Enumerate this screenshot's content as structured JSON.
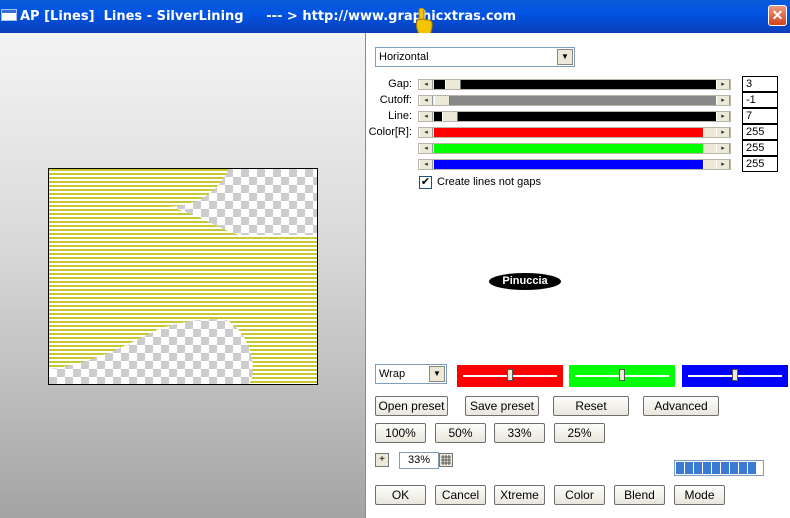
{
  "window": {
    "title": "AP [Lines]  Lines - SilverLining     --- > http://www.graphicxtras.com",
    "close_glyph": "✕"
  },
  "direction": {
    "selected": "Horizontal"
  },
  "params": [
    {
      "label": "Gap:",
      "value": "3",
      "color": "#000000",
      "level": 0.04
    },
    {
      "label": "Cutoff:",
      "value": "-1",
      "color": "#888888",
      "level": 0.0
    },
    {
      "label": "Line:",
      "value": "7",
      "color": "#000000",
      "level": 0.03
    },
    {
      "label": "Color[R]:",
      "value": "255",
      "color": "#ff0000",
      "level": 1.0
    },
    {
      "label": "",
      "value": "255",
      "color": "#00ff00",
      "level": 1.0
    },
    {
      "label": "",
      "value": "255",
      "color": "#0000ff",
      "level": 1.0
    }
  ],
  "checkbox": {
    "label": "Create lines not gaps",
    "checked": true,
    "glyph": "✔"
  },
  "pinuccia": "Pinuccia",
  "edge_mode": {
    "selected": "Wrap"
  },
  "color_sliders": [
    {
      "color": "#ff0000",
      "level": 0.5
    },
    {
      "color": "#00ff00",
      "level": 0.5
    },
    {
      "color": "#0000ff",
      "level": 0.5
    }
  ],
  "preset_buttons": {
    "open": "Open preset",
    "save": "Save preset",
    "reset": "Reset",
    "advanced": "Advanced"
  },
  "zoom_buttons": [
    "100%",
    "50%",
    "33%",
    "25%"
  ],
  "zoom": {
    "plus": "+",
    "value": "33%"
  },
  "bottom_buttons": {
    "ok": "OK",
    "cancel": "Cancel",
    "xtreme": "Xtreme",
    "color": "Color",
    "blend": "Blend",
    "mode": "Mode"
  },
  "progress": {
    "segments": 9
  },
  "icons": {
    "window": "window-icon",
    "close": "close-icon",
    "hand": "pointing-hand-icon",
    "dropdown": "chevron-down-icon"
  },
  "colors": {
    "titlebar": "#0054e3",
    "stripe_yellow": "#c8c832",
    "stripe_white": "#ffffff"
  }
}
